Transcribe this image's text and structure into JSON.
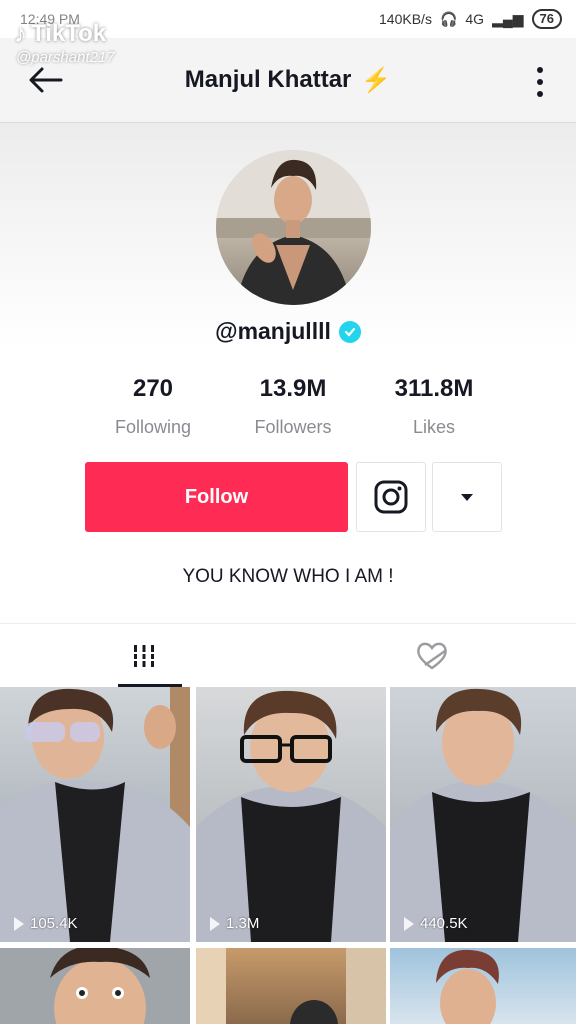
{
  "status_bar": {
    "time": "12:49 PM",
    "network_speed": "140KB/s",
    "signal": "4G",
    "battery": "76"
  },
  "watermark": {
    "brand": "TikTok",
    "handle": "@parshant217"
  },
  "header": {
    "title": "Manjul Khattar",
    "back_icon": "arrow-left-icon",
    "more_icon": "more-vertical-icon"
  },
  "profile": {
    "username": "@manjullll",
    "verified": true,
    "stats": [
      {
        "value": "270",
        "label": "Following"
      },
      {
        "value": "13.9M",
        "label": "Followers"
      },
      {
        "value": "311.8M",
        "label": "Likes"
      }
    ],
    "follow_label": "Follow",
    "bio": "YOU KNOW WHO I AM !"
  },
  "tabs": [
    {
      "name": "videos",
      "icon": "grid-icon",
      "active": true
    },
    {
      "name": "liked",
      "icon": "heart-hidden-icon",
      "active": false
    }
  ],
  "videos": [
    {
      "views": "105.4K"
    },
    {
      "views": "1.3M"
    },
    {
      "views": "440.5K"
    },
    {
      "views": ""
    },
    {
      "views": ""
    },
    {
      "views": ""
    }
  ],
  "colors": {
    "accent": "#fe2c55",
    "verified": "#20d5ec",
    "text": "#161823",
    "muted": "#8a8b91"
  }
}
